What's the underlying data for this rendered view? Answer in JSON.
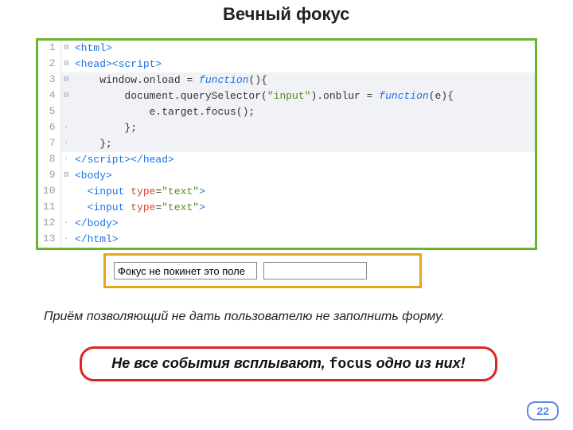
{
  "title": "Вечный фокус",
  "code": {
    "lines": [
      {
        "n": "1",
        "fold": "⊟",
        "hl": false,
        "tokens": [
          [
            "tag",
            "<html>"
          ]
        ]
      },
      {
        "n": "2",
        "fold": "⊟",
        "hl": false,
        "tokens": [
          [
            "tag",
            "<head><script>"
          ]
        ]
      },
      {
        "n": "3",
        "fold": "⊟",
        "hl": true,
        "tokens": [
          [
            "id",
            "    window.onload "
          ],
          [
            "punc",
            "= "
          ],
          [
            "kw",
            "function"
          ],
          [
            "punc",
            "(){"
          ]
        ]
      },
      {
        "n": "4",
        "fold": "⊟",
        "hl": true,
        "tokens": [
          [
            "id",
            "        document.querySelector("
          ],
          [
            "str",
            "\"input\""
          ],
          [
            "id",
            ").onblur "
          ],
          [
            "punc",
            "= "
          ],
          [
            "kw",
            "function"
          ],
          [
            "punc",
            "(e){"
          ]
        ]
      },
      {
        "n": "5",
        "fold": "",
        "hl": true,
        "tokens": [
          [
            "id",
            "            e.target.focus();"
          ]
        ]
      },
      {
        "n": "6",
        "fold": "·",
        "hl": true,
        "tokens": [
          [
            "punc",
            "        };"
          ]
        ]
      },
      {
        "n": "7",
        "fold": "·",
        "hl": true,
        "tokens": [
          [
            "punc",
            "    };"
          ]
        ]
      },
      {
        "n": "8",
        "fold": "·",
        "hl": false,
        "tokens": [
          [
            "tag",
            "</script></head>"
          ]
        ]
      },
      {
        "n": "9",
        "fold": "⊟",
        "hl": false,
        "tokens": [
          [
            "tag",
            "<body>"
          ]
        ]
      },
      {
        "n": "10",
        "fold": "",
        "hl": false,
        "tokens": [
          [
            "tag",
            "  <input "
          ],
          [
            "attr",
            "type"
          ],
          [
            "punc",
            "="
          ],
          [
            "str",
            "\"text\""
          ],
          [
            "tag",
            ">"
          ]
        ]
      },
      {
        "n": "11",
        "fold": "",
        "hl": false,
        "tokens": [
          [
            "tag",
            "  <input "
          ],
          [
            "attr",
            "type"
          ],
          [
            "punc",
            "="
          ],
          [
            "str",
            "\"text\""
          ],
          [
            "tag",
            ">"
          ]
        ]
      },
      {
        "n": "12",
        "fold": "·",
        "hl": false,
        "tokens": [
          [
            "tag",
            "</body>"
          ]
        ]
      },
      {
        "n": "13",
        "fold": "·",
        "hl": false,
        "tokens": [
          [
            "tag",
            "</html>"
          ]
        ]
      }
    ]
  },
  "focus_demo": {
    "input1_value": "Фокус не покинет это поле",
    "input2_value": ""
  },
  "description": "Приём позволяющий не дать пользователю не заполнить форму.",
  "callout": {
    "pre": "Не все события всплывают, ",
    "mono": "focus",
    "post": " одно из них!"
  },
  "page_number": "22"
}
